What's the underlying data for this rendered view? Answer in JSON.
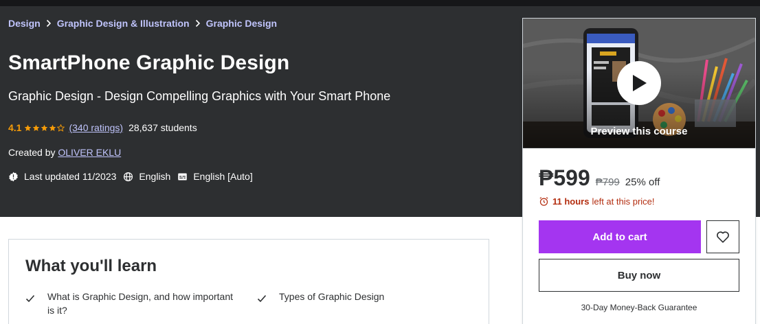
{
  "breadcrumb": {
    "items": [
      "Design",
      "Graphic Design & Illustration",
      "Graphic Design"
    ],
    "separator_icon": "chevron-right-icon"
  },
  "course": {
    "title": "SmartPhone Graphic Design",
    "subtitle": "Graphic Design - Design Compelling Graphics with Your Smart Phone",
    "rating": "4.1",
    "rating_value": 4.1,
    "ratings_text": "(340 ratings)",
    "students_text": "28,637 students",
    "created_by_label": "Created by",
    "author": "OLIVER EKLU",
    "last_updated": "Last updated 11/2023",
    "language": "English",
    "captions": "English [Auto]"
  },
  "learn": {
    "heading": "What you'll learn",
    "items": [
      "What is Graphic Design, and how important is it?",
      "Types of Graphic Design"
    ]
  },
  "sidebar": {
    "preview_label": "Preview this course",
    "price": "₱599",
    "original_price": "₱799",
    "discount": "25% off",
    "timer_bold": "11 hours",
    "timer_rest": "left at this price!",
    "add_to_cart": "Add to cart",
    "buy_now": "Buy now",
    "guarantee": "30-Day Money-Back Guarantee"
  },
  "colors": {
    "hero_bg": "#2d2f31",
    "accent_purple": "#a435f0",
    "link_lavender": "#c0c4fc",
    "star_orange": "#f69c08",
    "timer_red": "#b32d0f"
  }
}
